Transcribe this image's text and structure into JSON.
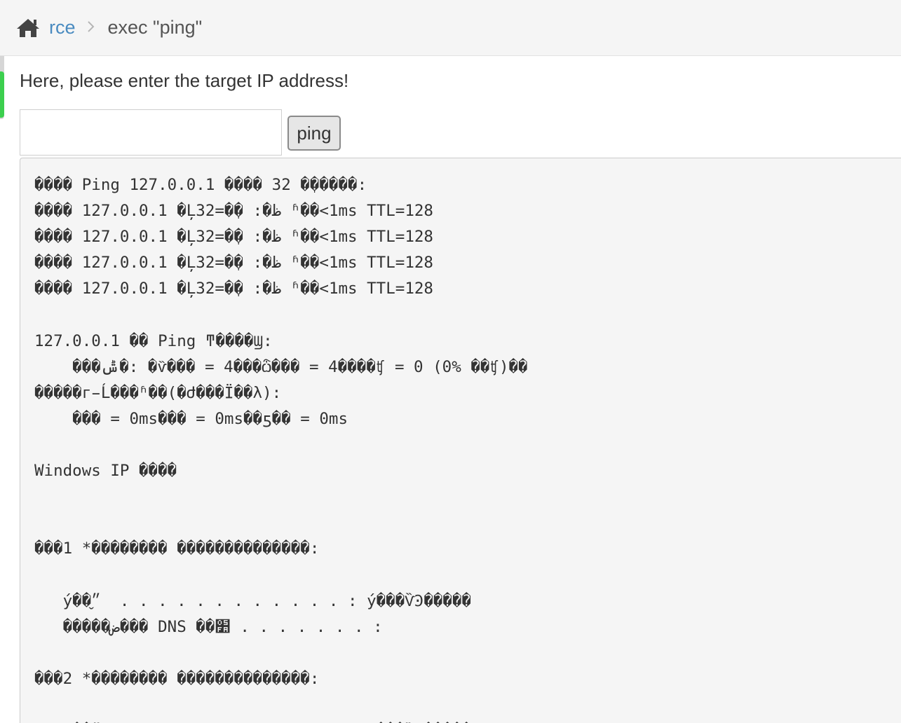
{
  "breadcrumb": {
    "home_icon": "home-icon",
    "link_label": "rce",
    "separator": ">",
    "current_label": "exec \"ping\""
  },
  "form": {
    "prompt_text": "Here, please enter the target IP address!",
    "ip_input_value": "",
    "ping_button_label": "ping"
  },
  "output": {
    "lines": [
      "���� Ping 127.0.0.1 ���� 32 �ֽ�����:",
      "���� 127.0.0.1 �Ļظ�: �ֽ�=32 ʱ��<1ms TTL=128",
      "���� 127.0.0.1 �Ļظ�: �ֽ�=32 ʱ��<1ms TTL=128",
      "���� 127.0.0.1 �Ļظ�: �ֽ�=32 ʱ��<1ms TTL=128",
      "���� 127.0.0.1 �Ļظ�: �ֽ�=32 ʱ��<1ms TTL=128",
      "",
      "127.0.0.1 �� Ping ͳ����Ϣ:",
      "    ���ݰ�: �ѷ��� = 4���ѽ��� = 4����ʧ = 0 (0% ��ʧ)��",
      "�����г̵Ĺ���ʱ��(�Ժ���Ϊ��λ):",
      "    ��� = 0ms��� = 0ms��ƽ�� = 0ms",
      "",
      "Windows IP ����",
      "",
      "",
      "���1 *�������� ��������������:",
      "",
      "   ý��״̬  . . . . . . . . . . . . : ý���ѶϿ�����",
      "   �����ض��� DNS ��׺ . . . . . . . :",
      "",
      "���2 *�������� ��������������:",
      "",
      "   ý��״̬  . . . . . . . . . . . . : ý���ѶϿ�����"
    ]
  }
}
